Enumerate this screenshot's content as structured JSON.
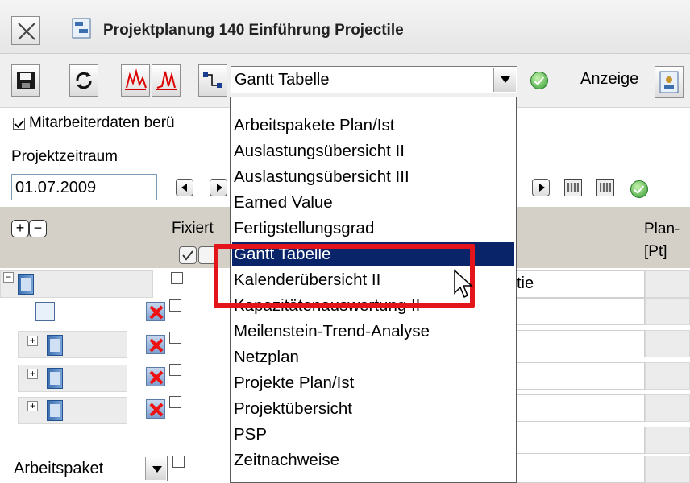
{
  "window": {
    "title": "Projektplanung 140 Einführung Projectile"
  },
  "toolbar": {
    "save_icon": "floppy-disk-icon",
    "refresh_icon": "refresh-icon",
    "view_select_value": "Gantt Tabelle",
    "anzeige_label": "Anzeige"
  },
  "options": {
    "mitarbeiterdaten_label": "Mitarbeiterdaten berü",
    "mitarbeiterdaten_checked": true
  },
  "zeitraum": {
    "label": "Projektzeitraum",
    "start_date": "01.07.2009"
  },
  "grid": {
    "fixiert_label": "Fixiert",
    "plan_header_line1": "Plan-",
    "plan_header_line2": "[Pt]",
    "row_text_fragment": "tie"
  },
  "bottom": {
    "type_select_value": "Arbeitspaket"
  },
  "dropdown": {
    "items": [
      "Arbeitspakete Plan/Ist",
      "Auslastungsübersicht II",
      "Auslastungsübersicht III",
      "Earned Value",
      "Fertigstellungsgrad",
      "Gantt Tabelle",
      "Kalenderübersicht II",
      "Kapazitätenauswertung II",
      "Meilenstein-Trend-Analyse",
      "Netzplan",
      "Projekte Plan/Ist",
      "Projektübersicht",
      "PSP",
      "Zeitnachweise"
    ],
    "selected": "Gantt Tabelle"
  },
  "colors": {
    "selection": "#0a246a",
    "highlight_frame": "#e3151a",
    "ok_green": "#2f9a2f"
  }
}
